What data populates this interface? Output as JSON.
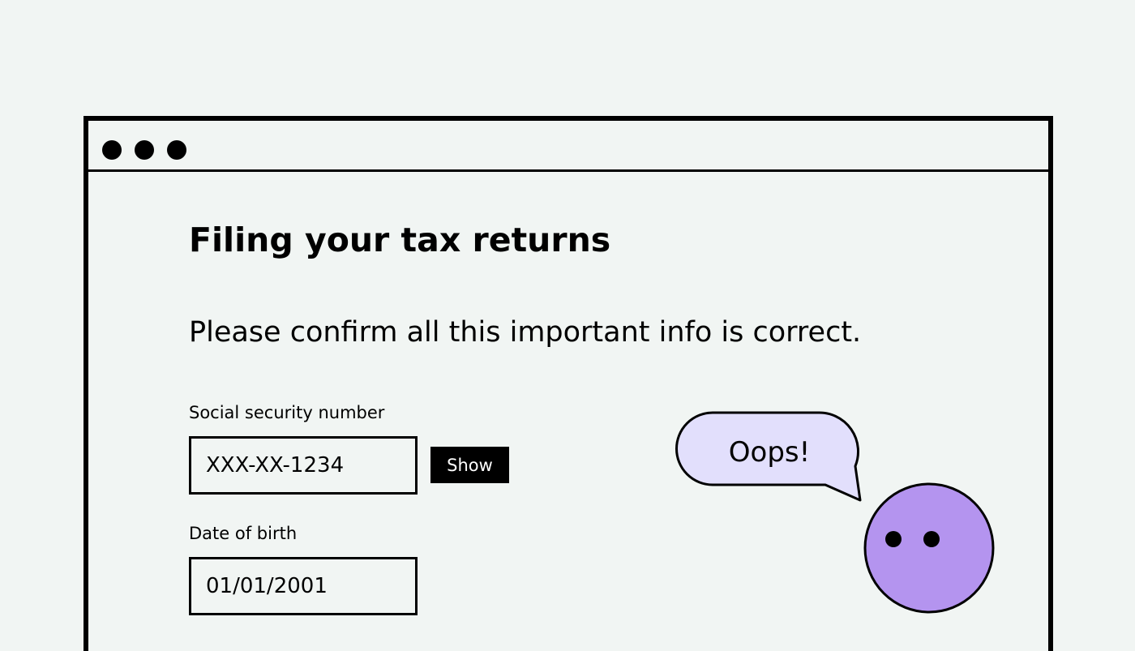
{
  "page": {
    "title": "Filing your tax returns",
    "intro": "Please confirm all this important info is correct."
  },
  "form": {
    "ssn": {
      "label": "Social security number",
      "value": "XXX-XX-1234",
      "show_label": "Show"
    },
    "dob": {
      "label": "Date of birth",
      "value": "01/01/2001"
    }
  },
  "assistant": {
    "message": "Oops!",
    "bubble_color": "#e2dffc",
    "face_color": "#b494ef"
  },
  "colors": {
    "background": "#f1f5f3",
    "ink": "#000000"
  }
}
